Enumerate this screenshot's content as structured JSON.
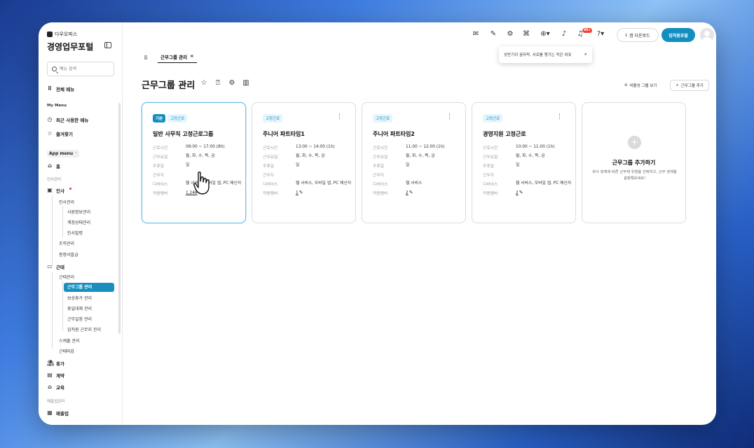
{
  "sidebar": {
    "brand": "다우오피스",
    "portal_title": "경영업무포털",
    "search_placeholder": "메뉴 검색",
    "all_menu": "전체 메뉴",
    "my_menu_label": "My Menu",
    "recent_menu": "최근 사용한 메뉴",
    "favorites": "즐겨찾기",
    "app_menu_label": "App menu",
    "home": "홈",
    "hr_section": "인사관리",
    "hr": "인사",
    "hr_sub": "인사관리",
    "hr_sub_items": [
      "사원정보관리",
      "계정상태관리",
      "인사발령"
    ],
    "org_mgmt": "조직관리",
    "certificate": "증명서발급",
    "attendance": "근태",
    "attendance_sub": "근태관리",
    "attendance_sub_items": [
      "근무그룹 관리",
      "보상휴가 관리",
      "휴일대체 관리",
      "근무일정 관리",
      "임직원 근무지 관리"
    ],
    "schedule_mgmt": "스케줄 관리",
    "attendance_close": "근태마감",
    "vacation": "휴가",
    "contract": "계약",
    "education": "교육",
    "sales_section": "매출업관리",
    "sales": "매출업"
  },
  "topbar": {
    "notif_badge": "99+",
    "download_label": "앱 다운로드",
    "portal_button": "임직원포털"
  },
  "tabs": {
    "home": "홈",
    "active": "근무그룹 관리",
    "close": "×"
  },
  "tooltip": {
    "text": "상반기의 꿈자락, 서로를 챙기는 작은 여유",
    "close": "×"
  },
  "page": {
    "title": "근무그룹 관리",
    "hidden_groups": "비활성 그룹 보기",
    "add_group": "근무그룹 추가"
  },
  "labels": {
    "work_time": "근로시간",
    "work_days": "근무요일",
    "holiday": "주휴일",
    "workplace": "근무지",
    "device": "디바이스",
    "members": "적용멤버"
  },
  "cards": [
    {
      "base_tag": "기본",
      "type": "고정근로",
      "name": "일반 사무직 고정근로그룹",
      "work_time": "08:00 ~ 17:00 (8h)",
      "work_days": "월, 화, 수, 목, 금",
      "holiday": "일",
      "workplace": "",
      "device": "웹 서비스, 모바일 앱, PC 메신저",
      "members": "1,246"
    },
    {
      "base_tag": "",
      "type": "고정근로",
      "name": "주니어 파트타임1",
      "work_time": "13:00 ~ 14:00 (1h)",
      "work_days": "월, 화, 수, 목, 금",
      "holiday": "일",
      "workplace": "",
      "device": "웹 서비스, 모바일 앱, PC 메신저",
      "members": "1"
    },
    {
      "base_tag": "",
      "type": "고정근로",
      "name": "주니어 파트타임2",
      "work_time": "11:00 ~ 12:00 (1h)",
      "work_days": "월, 화, 수, 목, 금",
      "holiday": "일",
      "workplace": "",
      "device": "웹 서비스",
      "members": "2"
    },
    {
      "base_tag": "",
      "type": "고정근로",
      "name": "경영지원 고정근로",
      "work_time": "10:00 ~ 11:00 (1h)",
      "work_days": "월, 화, 수, 목, 금",
      "holiday": "일",
      "workplace": "",
      "device": "웹 서비스, 모바일 앱, PC 메신저",
      "members": "2"
    }
  ],
  "add_card": {
    "plus": "+",
    "title": "근무그룹 추가하기",
    "desc": "회사 정책에 따른 근무제 유형을 선택하고, 근무 정책을 설정해보세요!"
  },
  "colors": {
    "accent": "#138fbf",
    "tag_bg": "#e6f4fb",
    "badge": "#f04438"
  }
}
